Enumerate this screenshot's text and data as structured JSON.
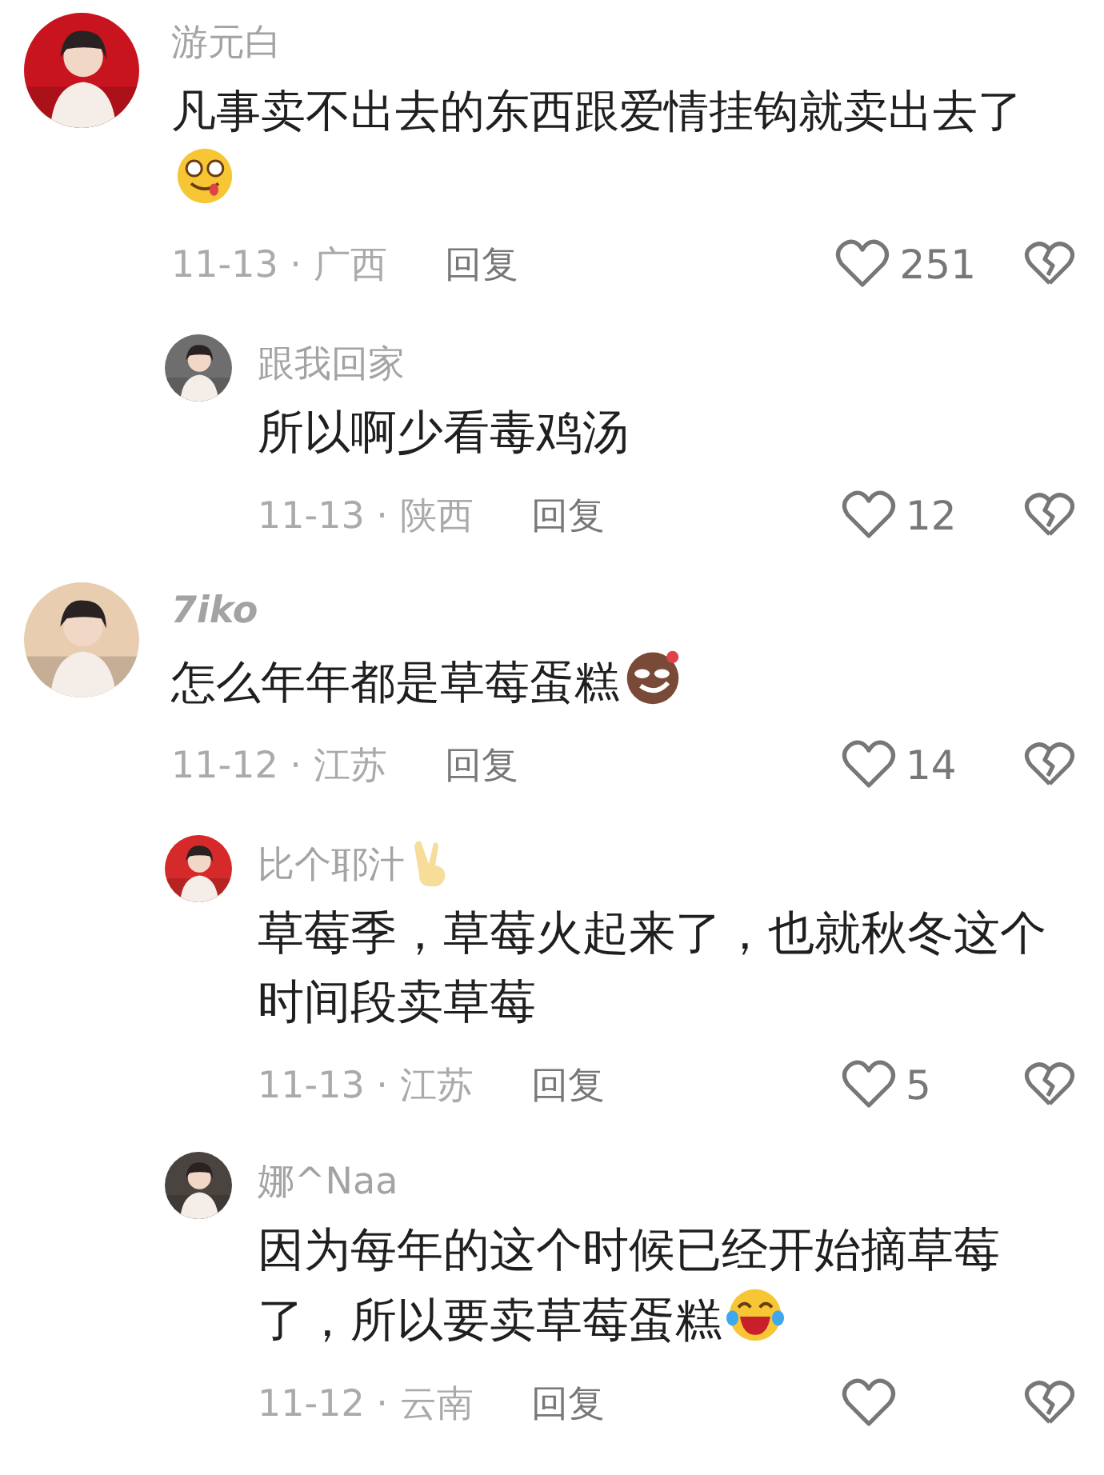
{
  "comments": [
    {
      "user": "游元白",
      "bold_name": false,
      "text": "凡事卖不出去的东西跟爱情挂钩就卖出去了",
      "emoji": {
        "kind": "drool"
      },
      "meta": "11-13 · 广西",
      "reply_label": "回复",
      "likes": "251",
      "replies": [
        {
          "user": "跟我回家",
          "bold_name": false,
          "text": "所以啊少看毒鸡汤",
          "meta": "11-13 · 陕西",
          "reply_label": "回复",
          "likes": "12"
        }
      ]
    },
    {
      "user": "7iko",
      "bold_name": true,
      "text": "怎么年年都是草莓蛋糕",
      "emoji": {
        "kind": "smirk"
      },
      "meta": "11-12 · 江苏",
      "reply_label": "回复",
      "likes": "14",
      "replies": [
        {
          "user": "比个耶汁",
          "bold_name": false,
          "name_icon": {
            "kind": "victory"
          },
          "text": "草莓季，草莓火起来了，也就秋冬这个时间段卖草莓",
          "meta": "11-13 · 江苏",
          "reply_label": "回复",
          "likes": "5"
        },
        {
          "user": "娜^Naa",
          "bold_name": false,
          "text": "因为每年的这个时候已经开始摘草莓了，所以要卖草莓蛋糕",
          "emoji": {
            "kind": "laugh"
          },
          "meta": "11-12 · 云南",
          "reply_label": "回复"
        }
      ]
    }
  ]
}
